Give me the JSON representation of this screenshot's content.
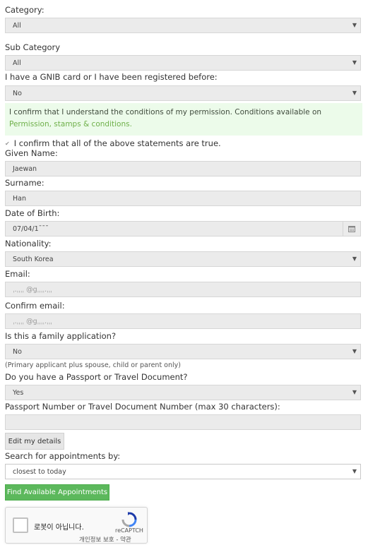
{
  "category": {
    "label": "Category:",
    "value": "All"
  },
  "sub_category": {
    "label": "Sub Category",
    "value": "All"
  },
  "gnib": {
    "label": "I have a GNIB card or I have been registered before:",
    "value": "No"
  },
  "notice": {
    "text": "I confirm that I understand the conditions of my permission. Conditions available on",
    "link": "Permission, stamps & conditions."
  },
  "confirm": {
    "label": "I confirm that all of the above statements are true.",
    "checked": true
  },
  "given_name": {
    "label": "Given Name:",
    "value": "Jaewan"
  },
  "surname": {
    "label": "Surname:",
    "value": "Han"
  },
  "dob": {
    "label": "Date of Birth:",
    "value": "07/04/1ˉˉˉ"
  },
  "nationality": {
    "label": "Nationality:",
    "value": "South Korea"
  },
  "email": {
    "label": "Email:",
    "value": "ˌ.ˌˌˌˌ @gˌˌˌˌ.ˌˌˌ"
  },
  "confirm_email": {
    "label": "Confirm email:",
    "value": "ˌ.ˌˌˌˌ @gˌˌˌˌ.ˌˌˌ"
  },
  "family": {
    "label": "Is this a family application?",
    "value": "No",
    "help": "(Primary applicant plus spouse, child or parent only)"
  },
  "passport": {
    "label": "Do you have a Passport or Travel Document?",
    "value": "Yes"
  },
  "passport_number": {
    "label": "Passport Number or Travel Document Number (max 30 characters):",
    "value": ""
  },
  "edit_button": "Edit my details",
  "search": {
    "label": "Search for appointments by:",
    "value": "closest to today"
  },
  "find_button": "Find Available Appointments",
  "captcha": {
    "text": "로봇이 아닙니다.",
    "brand": "reCAPTCH",
    "privacy": "개인정보 보호 - 약관"
  },
  "colors": {
    "field_bg": "#ebebeb",
    "notice_bg": "#ecfbea",
    "link": "#6fb04a",
    "button_green": "#5cb85c"
  },
  "icons": {
    "dropdown": "chevron-down-icon",
    "calendar": "calendar-icon",
    "checkbox": "checkbox-icon",
    "recaptcha": "recaptcha-logo"
  }
}
